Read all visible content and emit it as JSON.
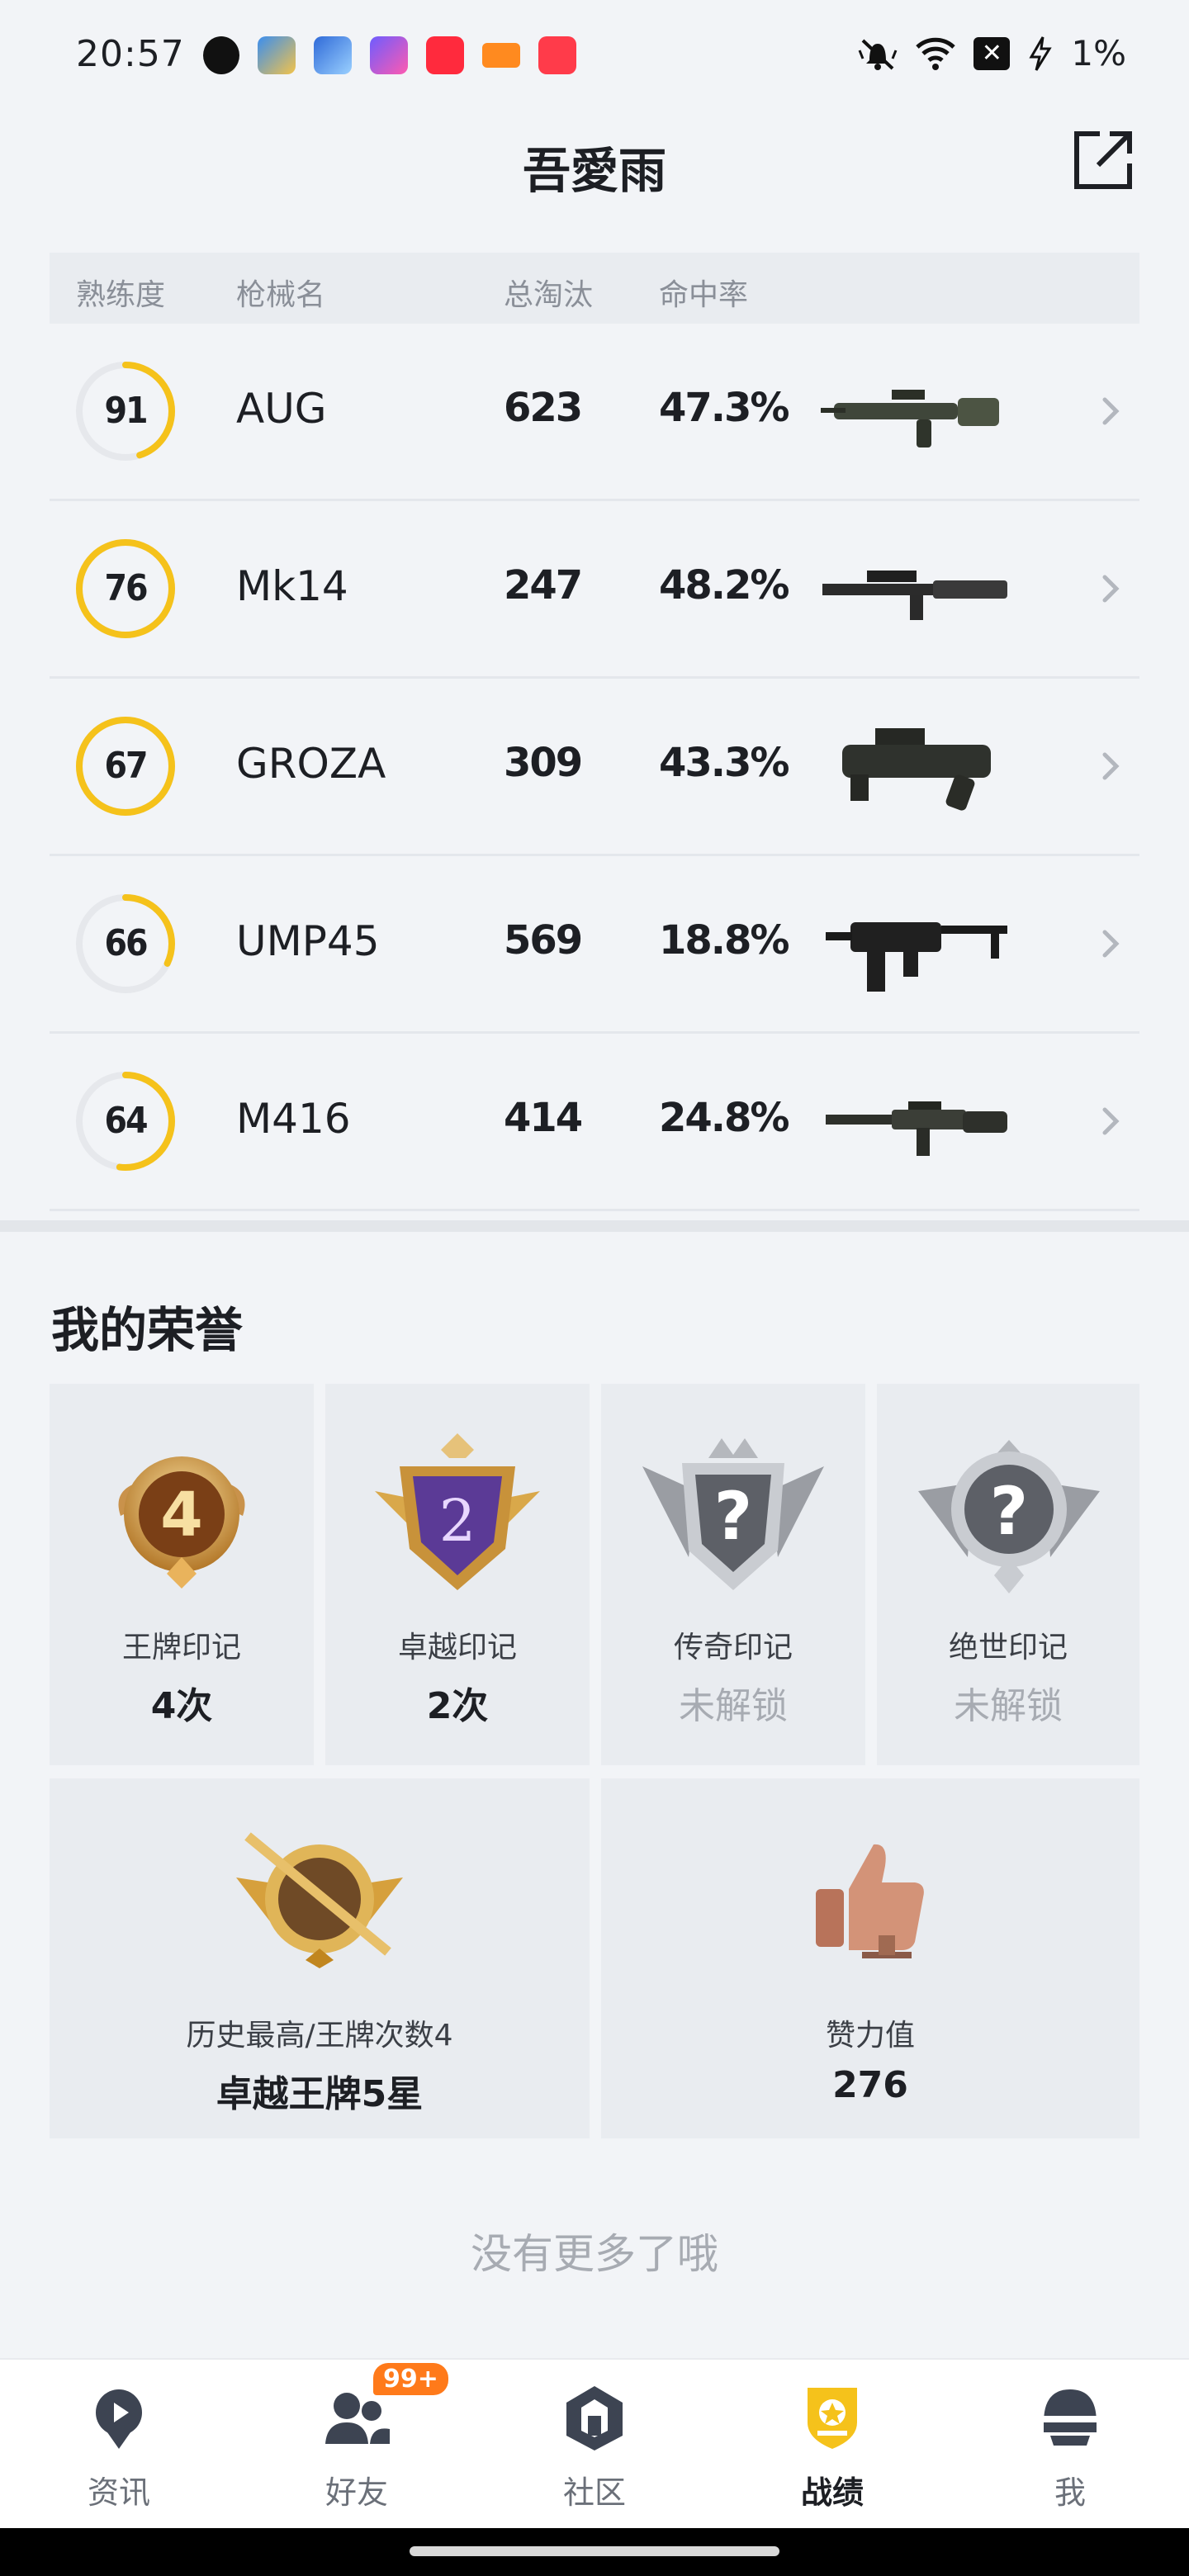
{
  "status_bar": {
    "time": "20:57",
    "battery_text": "1%",
    "notification_icons": [
      "wechat-icon",
      "game-app-icon",
      "game-app-icon",
      "star-app-icon",
      "music-app-icon",
      "game-app-icon",
      "video-app-icon"
    ],
    "system_icons": [
      "mute-vibrate-icon",
      "wifi-icon",
      "battery-x-icon",
      "charging-icon"
    ]
  },
  "header": {
    "title": "吾愛雨",
    "share_icon": "share-external-icon"
  },
  "table": {
    "columns": [
      "熟练度",
      "枪械名",
      "总淘汰",
      "命中率"
    ],
    "rows": [
      {
        "proficiency": "91",
        "level": 0.45,
        "name": "AUG",
        "kills": "623",
        "accuracy": "47.3%",
        "gun_icon": "aug-rifle-icon"
      },
      {
        "proficiency": "76",
        "level": 1.0,
        "name": "Mk14",
        "kills": "247",
        "accuracy": "48.2%",
        "gun_icon": "mk14-rifle-icon"
      },
      {
        "proficiency": "67",
        "level": 1.0,
        "name": "GROZA",
        "kills": "309",
        "accuracy": "43.3%",
        "gun_icon": "groza-rifle-icon"
      },
      {
        "proficiency": "66",
        "level": 0.32,
        "name": "UMP45",
        "kills": "569",
        "accuracy": "18.8%",
        "gun_icon": "ump45-smg-icon"
      },
      {
        "proficiency": "64",
        "level": 0.52,
        "name": "M416",
        "kills": "414",
        "accuracy": "24.8%",
        "gun_icon": "m416-rifle-icon"
      }
    ]
  },
  "honors": {
    "title": "我的荣誉",
    "marks": [
      {
        "label": "王牌印记",
        "value": "4次",
        "locked": false,
        "badge_text": "4"
      },
      {
        "label": "卓越印记",
        "value": "2次",
        "locked": false,
        "badge_text": "2"
      },
      {
        "label": "传奇印记",
        "value": "未解锁",
        "locked": true,
        "badge_text": "?"
      },
      {
        "label": "绝世印记",
        "value": "未解锁",
        "locked": true,
        "badge_text": "?"
      }
    ],
    "highest": {
      "label": "历史最高/王牌次数4",
      "value": "卓越王牌5星"
    },
    "likes": {
      "label": "赞力值",
      "value": "276"
    }
  },
  "footer_text": "没有更多了哦",
  "colors": {
    "accent_yellow": "#f5c21b",
    "ring_track": "#e6e8ec"
  },
  "bottom_nav": {
    "items": [
      {
        "label": "资讯",
        "icon": "news-icon",
        "active": false
      },
      {
        "label": "好友",
        "icon": "friends-icon",
        "active": false,
        "badge": "99+"
      },
      {
        "label": "社区",
        "icon": "community-icon",
        "active": false
      },
      {
        "label": "战绩",
        "icon": "record-icon",
        "active": true
      },
      {
        "label": "我",
        "icon": "profile-helmet-icon",
        "active": false
      }
    ]
  }
}
